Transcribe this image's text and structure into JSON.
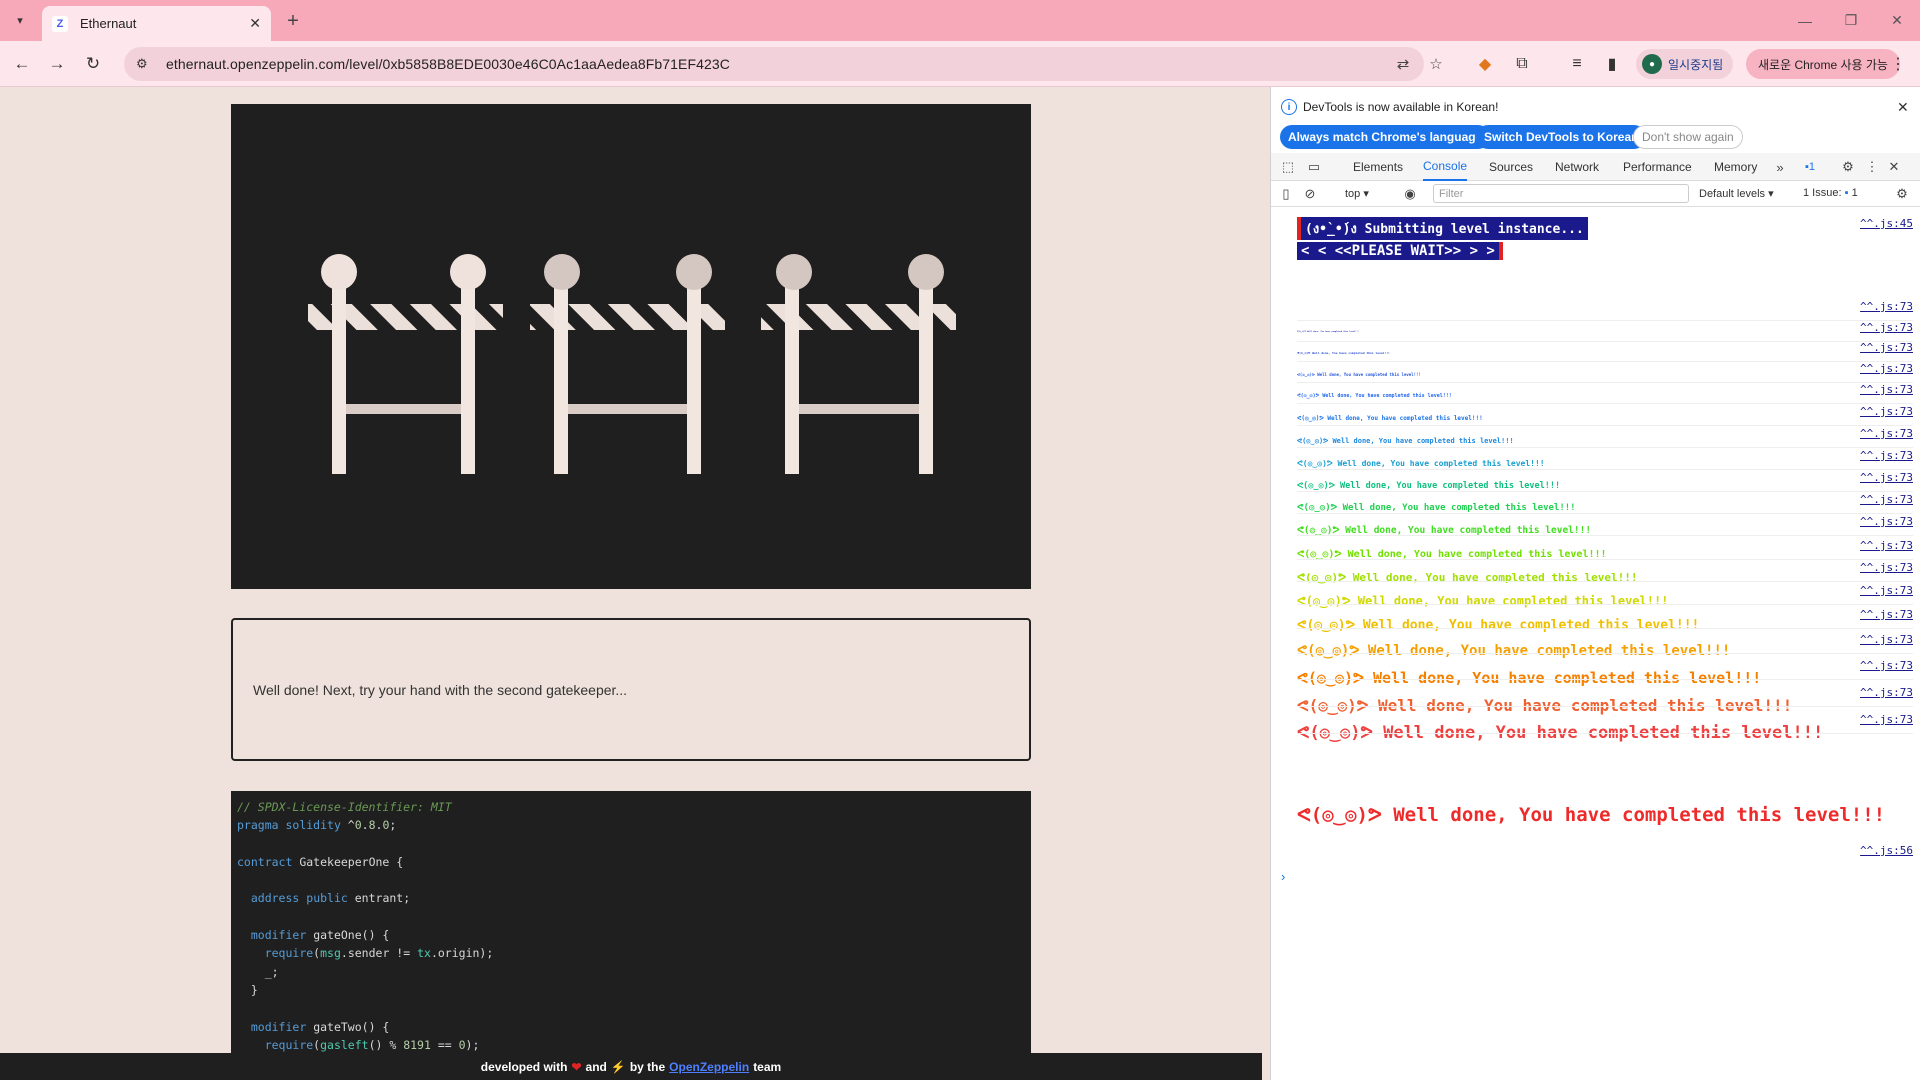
{
  "browser": {
    "tab_title": "Ethernaut",
    "url": "ethernaut.openzeppelin.com/level/0xb5858B8EDE0030e46C0Ac1aaAedea8Fb71EF423C",
    "profile_label": "일시중지됨",
    "chrome_pill_label": "새로운 Chrome 사용 가능"
  },
  "page": {
    "message": "Well done! Next, try your hand with the second gatekeeper...",
    "code_lines": [
      "// SPDX-License-Identifier: MIT",
      "pragma solidity ^0.8.0;",
      "",
      "contract GatekeeperOne {",
      "",
      "  address public entrant;",
      "",
      "  modifier gateOne() {",
      "    require(msg.sender != tx.origin);",
      "    _;",
      "  }",
      "",
      "  modifier gateTwo() {",
      "    require(gasleft() % 8191 == 0);"
    ],
    "footer": {
      "prefix": "developed with",
      "and": "and",
      "by_the": "by the",
      "link": "OpenZeppelin",
      "suffix": "team"
    }
  },
  "devtools": {
    "info_text": "DevTools is now available in Korean!",
    "btn_match": "Always match Chrome's language",
    "btn_switch": "Switch DevTools to Korean",
    "btn_dont_show": "Don't show again",
    "tabs": [
      "Elements",
      "Console",
      "Sources",
      "Network",
      "Performance",
      "Memory"
    ],
    "active_tab": "Console",
    "badge_count": "1",
    "context": "top",
    "filter_placeholder": "Filter",
    "levels": "Default levels",
    "issues_label": "1 Issue:",
    "issues_count": "1",
    "submit_line1": "(ง•̀_•́)ง Submitting level instance...",
    "submit_line2": "< < <<PLEASE WAIT>> > >",
    "src_45": "^^.js:45",
    "src_73": "^^.js:73",
    "src_56": "^^.js:56",
    "done_text": "ᕙ(◎‿◎)ᕗ Well done, You have completed this level!!!"
  }
}
